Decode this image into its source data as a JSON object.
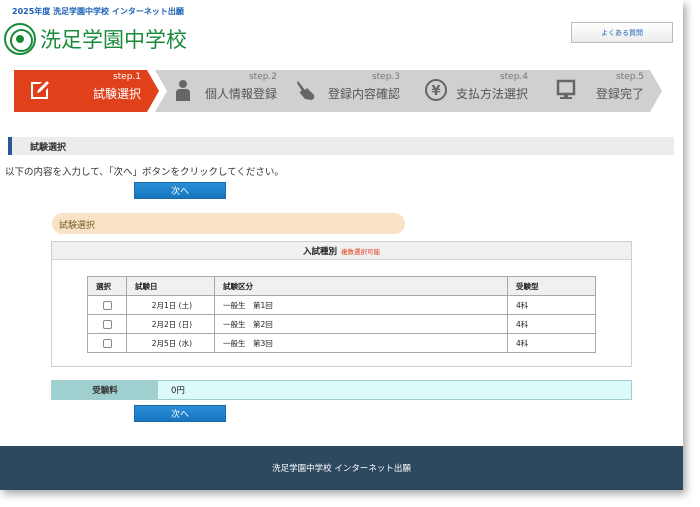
{
  "header": {
    "top_text": "2025年度 洗足学園中学校 インターネット出願",
    "logo_text": "洗足学園中学校",
    "faq_label": "よくある質問"
  },
  "steps": [
    {
      "num": "step.1",
      "label": "試験選択",
      "icon": "pencil-icon",
      "state": "active"
    },
    {
      "num": "step.2",
      "label": "個人情報登録",
      "icon": "person-icon",
      "state": "inactive"
    },
    {
      "num": "step.3",
      "label": "登録内容確認",
      "icon": "hand-pointer-icon",
      "state": "inactive"
    },
    {
      "num": "step.4",
      "label": "支払方法選択",
      "icon": "yen-icon",
      "state": "inactive"
    },
    {
      "num": "step.5",
      "label": "登録完了",
      "icon": "monitor-icon",
      "state": "inactive"
    }
  ],
  "section": {
    "title": "試験選択"
  },
  "instruction": "以下の内容を入力して、「次へ」ボタンをクリックしてください。",
  "next_label": "次へ",
  "exam": {
    "pill_title": "試験選択",
    "box_title": "入試種別",
    "multi_note": "複数選択可能",
    "columns": [
      "選択",
      "試験日",
      "試験区分",
      "受験型"
    ],
    "rows": [
      {
        "date": "2月1日 (土)",
        "category": "一般生　第1回",
        "type": "4科",
        "checked": false
      },
      {
        "date": "2月2日 (日)",
        "category": "一般生　第2回",
        "type": "4科",
        "checked": false
      },
      {
        "date": "2月5日 (水)",
        "category": "一般生　第3回",
        "type": "4科",
        "checked": false
      }
    ]
  },
  "fee": {
    "label": "受験料",
    "value": "0円"
  },
  "footer": {
    "text": "洗足学園中学校 インターネット出願"
  },
  "colors": {
    "accent": "#e0411b",
    "brand_green": "#1a8a3a",
    "footer_bg": "#2d4960",
    "button_blue": "#1f84cc"
  }
}
